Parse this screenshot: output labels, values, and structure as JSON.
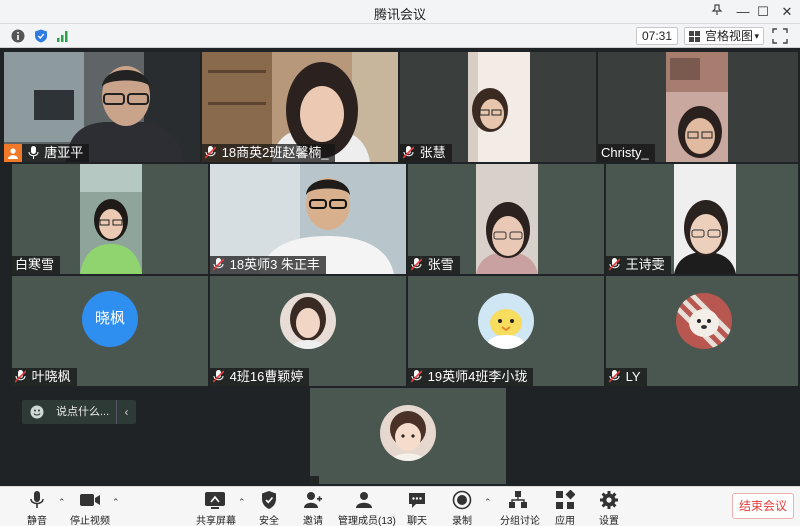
{
  "window": {
    "title": "腾讯会议"
  },
  "infobar": {
    "timer": "07:31",
    "view_label": "宫格视图"
  },
  "participants": [
    {
      "name": "唐亚平",
      "speaking": true
    },
    {
      "name": "18商英2班赵馨楠_"
    },
    {
      "name": "张慧"
    },
    {
      "name": "Christy_"
    },
    {
      "name": "白寒雪"
    },
    {
      "name": "18英师3 朱正丰"
    },
    {
      "name": "张雪"
    },
    {
      "name": "王诗雯"
    },
    {
      "name": "叶晓枫",
      "avatar_text": "晓枫",
      "avatar_color": "#2f8ff0"
    },
    {
      "name": "4班16曹颖婷"
    },
    {
      "name": "19英师4班李小珑"
    },
    {
      "name": "LY"
    },
    {
      "name": ""
    }
  ],
  "chat": {
    "placeholder": "说点什么..."
  },
  "toolbar": {
    "mute": "静音",
    "stop_video": "停止视频",
    "share_screen": "共享屏幕",
    "security": "安全",
    "invite": "邀请",
    "members": "管理成员(13)",
    "chat": "聊天",
    "record": "录制",
    "breakout": "分组讨论",
    "apps": "应用",
    "settings": "设置",
    "end_meeting": "结束会议"
  },
  "colors": {
    "accent": "#2f8ff0",
    "end": "#e23b3b",
    "tile_bg": "#4a5750",
    "muted_icon": "#e23b3b"
  }
}
